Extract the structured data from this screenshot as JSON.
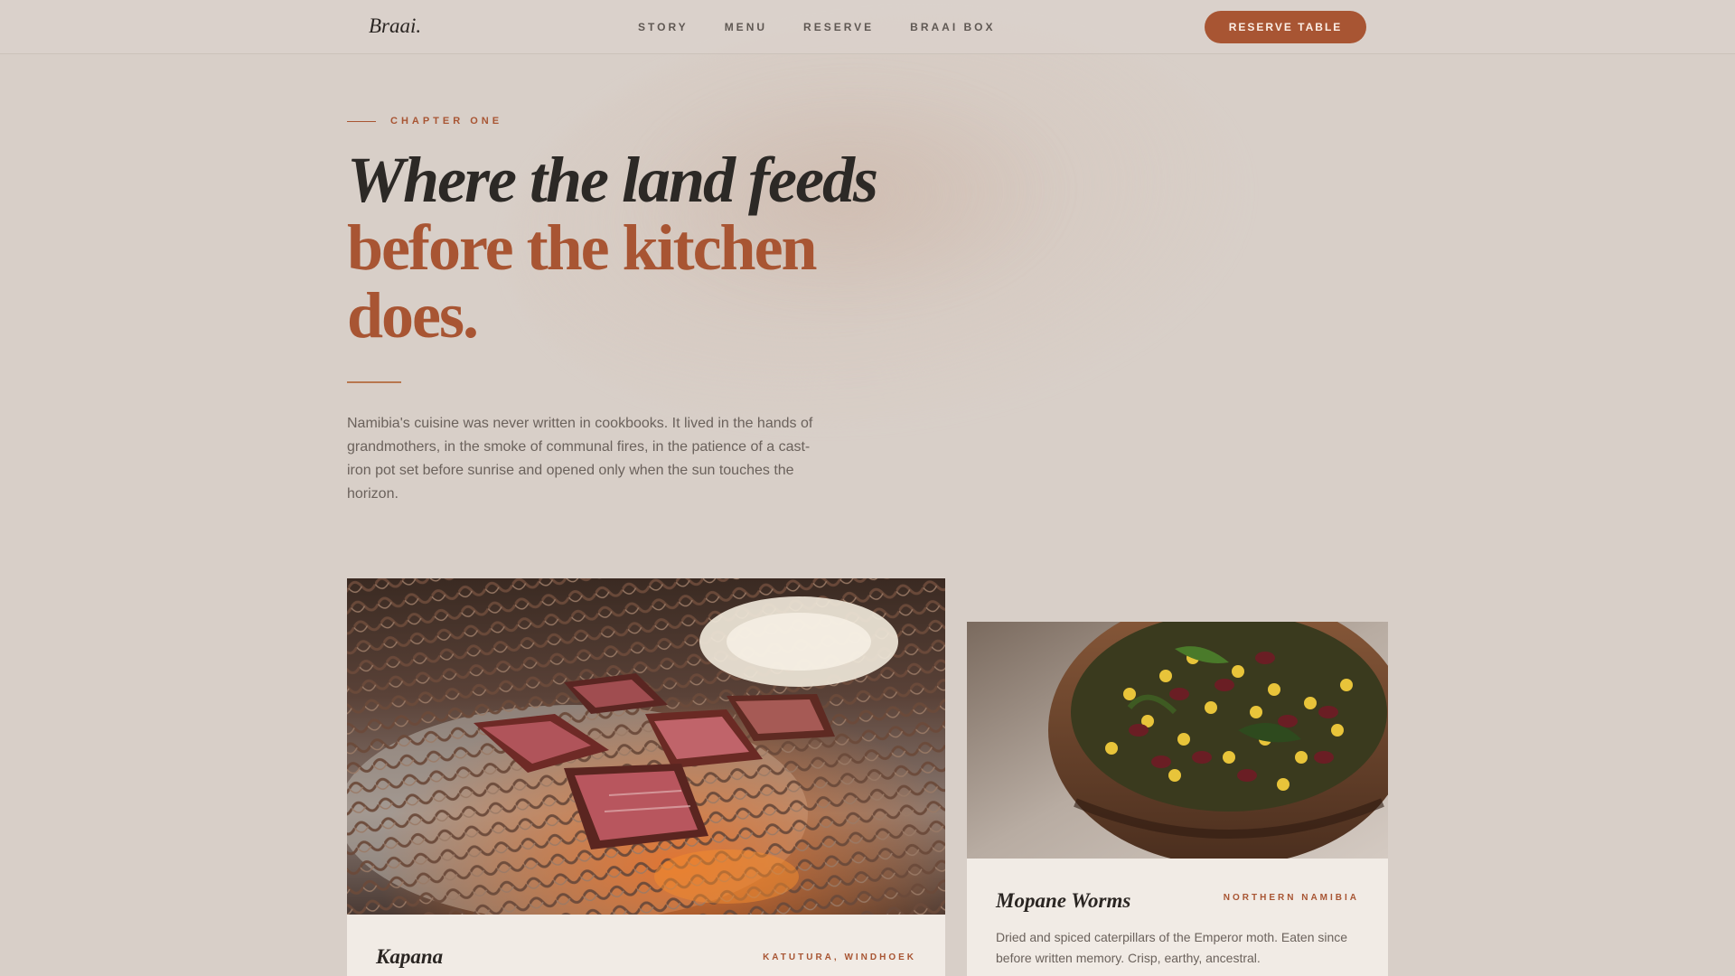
{
  "brand": {
    "logo": "Braai."
  },
  "nav": {
    "links": [
      "STORY",
      "MENU",
      "RESERVE",
      "BRAAI BOX"
    ],
    "cta": "RESERVE TABLE"
  },
  "hero": {
    "eyebrow": "CHAPTER ONE",
    "headline_line1": "Where the land feeds",
    "headline_line2": "before the kitchen",
    "headline_line3": "does.",
    "intro": "Namibia's cuisine was never written in cookbooks. It lived in the hands of grandmothers, in the smoke of communal fires, in the patience of a cast-iron pot set before sunrise and opened only when the sun touches the horizon."
  },
  "dishes": [
    {
      "title": "Kapana",
      "region": "KATUTURA, WINDHOEK",
      "image_icon": "grilled-meat-photo"
    },
    {
      "title": "Mopane Worms",
      "region": "NORTHERN NAMIBIA",
      "description": "Dried and spiced caterpillars of the Emperor moth. Eaten since before written memory. Crisp, earthy, ancestral.",
      "image_icon": "bean-corn-bowl-photo"
    }
  ],
  "colors": {
    "background": "#d8cfc8",
    "accent": "#a85533",
    "text": "#2a2522",
    "muted": "#6b625c",
    "card": "#f1ebe5"
  }
}
